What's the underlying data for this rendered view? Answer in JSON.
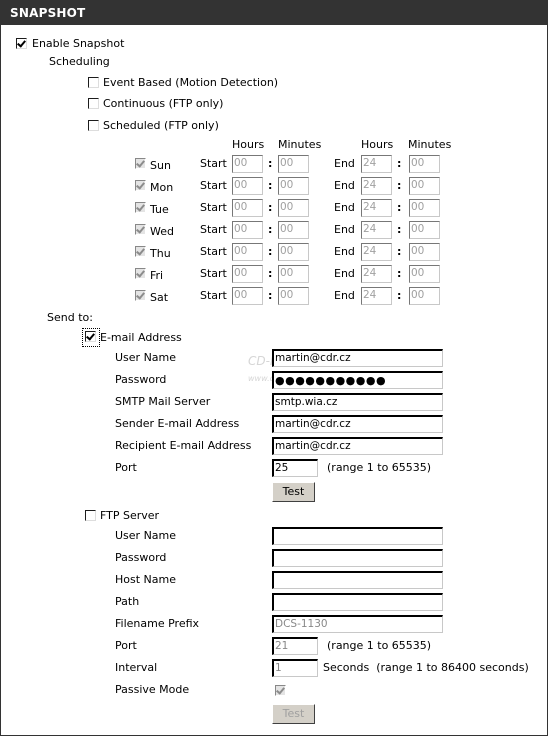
{
  "header": {
    "title": "SNAPSHOT"
  },
  "enable_snapshot": {
    "label": "Enable Snapshot",
    "checked": true
  },
  "scheduling": {
    "label": "Scheduling",
    "options": [
      {
        "label": "Event Based (Motion Detection)",
        "checked": false
      },
      {
        "label": "Continuous (FTP only)",
        "checked": false
      },
      {
        "label": "Scheduled (FTP only)",
        "checked": false
      }
    ],
    "columns": {
      "hours": "Hours",
      "minutes": "Minutes"
    },
    "start_label": "Start",
    "end_label": "End",
    "separator": ":",
    "days": [
      {
        "day": "Sun",
        "checked": true,
        "start_h": "00",
        "start_m": "00",
        "end_h": "24",
        "end_m": "00"
      },
      {
        "day": "Mon",
        "checked": true,
        "start_h": "00",
        "start_m": "00",
        "end_h": "24",
        "end_m": "00"
      },
      {
        "day": "Tue",
        "checked": true,
        "start_h": "00",
        "start_m": "00",
        "end_h": "24",
        "end_m": "00"
      },
      {
        "day": "Wed",
        "checked": true,
        "start_h": "00",
        "start_m": "00",
        "end_h": "24",
        "end_m": "00"
      },
      {
        "day": "Thu",
        "checked": true,
        "start_h": "00",
        "start_m": "00",
        "end_h": "24",
        "end_m": "00"
      },
      {
        "day": "Fri",
        "checked": true,
        "start_h": "00",
        "start_m": "00",
        "end_h": "24",
        "end_m": "00"
      },
      {
        "day": "Sat",
        "checked": true,
        "start_h": "00",
        "start_m": "00",
        "end_h": "24",
        "end_m": "00"
      }
    ]
  },
  "send_to": {
    "label": "Send to:"
  },
  "email": {
    "label": "E-mail Address",
    "checked": true,
    "fields": {
      "user_name": {
        "label": "User Name",
        "value": "martin@cdr.cz"
      },
      "password": {
        "label": "Password",
        "value": "●●●●●●●●●●●"
      },
      "smtp": {
        "label": "SMTP Mail Server",
        "value": "smtp.wia.cz"
      },
      "sender": {
        "label": "Sender E-mail Address",
        "value": "martin@cdr.cz"
      },
      "recipient": {
        "label": "Recipient E-mail Address",
        "value": "martin@cdr.cz"
      },
      "port": {
        "label": "Port",
        "value": "25",
        "hint": "(range 1 to 65535)"
      }
    },
    "test_label": "Test"
  },
  "ftp": {
    "label": "FTP Server",
    "checked": false,
    "fields": {
      "user_name": {
        "label": "User Name",
        "value": ""
      },
      "password": {
        "label": "Password",
        "value": ""
      },
      "host": {
        "label": "Host Name",
        "value": ""
      },
      "path": {
        "label": "Path",
        "value": ""
      },
      "prefix": {
        "label": "Filename Prefix",
        "value": "DCS-1130"
      },
      "port": {
        "label": "Port",
        "value": "21",
        "hint": "(range 1 to 65535)"
      },
      "interval": {
        "label": "Interval",
        "value": "1",
        "hint": "Seconds  (range 1 to 86400 seconds)"
      },
      "passive": {
        "label": "Passive Mode",
        "checked": true
      }
    },
    "test_label": "Test"
  },
  "watermark": {
    "line1": "CD-R",
    "line2": "www.cdr.cz"
  }
}
